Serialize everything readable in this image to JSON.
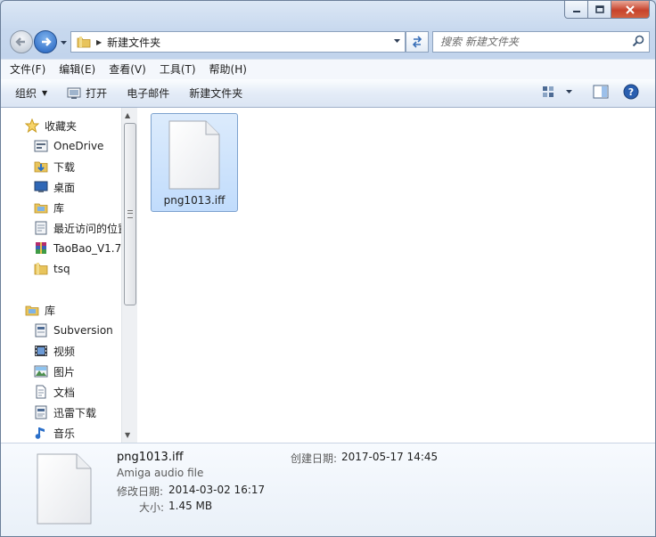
{
  "address": {
    "path": "新建文件夹"
  },
  "search": {
    "placeholder": "搜索 新建文件夹"
  },
  "menu": [
    "文件(F)",
    "编辑(E)",
    "查看(V)",
    "工具(T)",
    "帮助(H)"
  ],
  "commands": {
    "organize": "组织",
    "open": "打开",
    "email": "电子邮件",
    "new_folder": "新建文件夹"
  },
  "sidebar": {
    "favorites": {
      "label": "收藏夹",
      "items": [
        "OneDrive",
        "下载",
        "桌面",
        "库",
        "最近访问的位置",
        "TaoBao_V1.7",
        "tsq"
      ]
    },
    "libraries": {
      "label": "库",
      "items": [
        "Subversion",
        "视频",
        "图片",
        "文档",
        "迅雷下载",
        "音乐"
      ]
    }
  },
  "files": [
    {
      "name": "png1013.iff"
    }
  ],
  "details": {
    "name": "png1013.iff",
    "type": "Amiga audio file",
    "created_label": "创建日期:",
    "created_value": "2017-05-17 14:45",
    "modified_label": "修改日期:",
    "modified_value": "2014-03-02 16:17",
    "size_label": "大小:",
    "size_value": "1.45 MB"
  },
  "colors": {
    "accent": "#1f5fbd",
    "selection": "#cce4fc"
  }
}
